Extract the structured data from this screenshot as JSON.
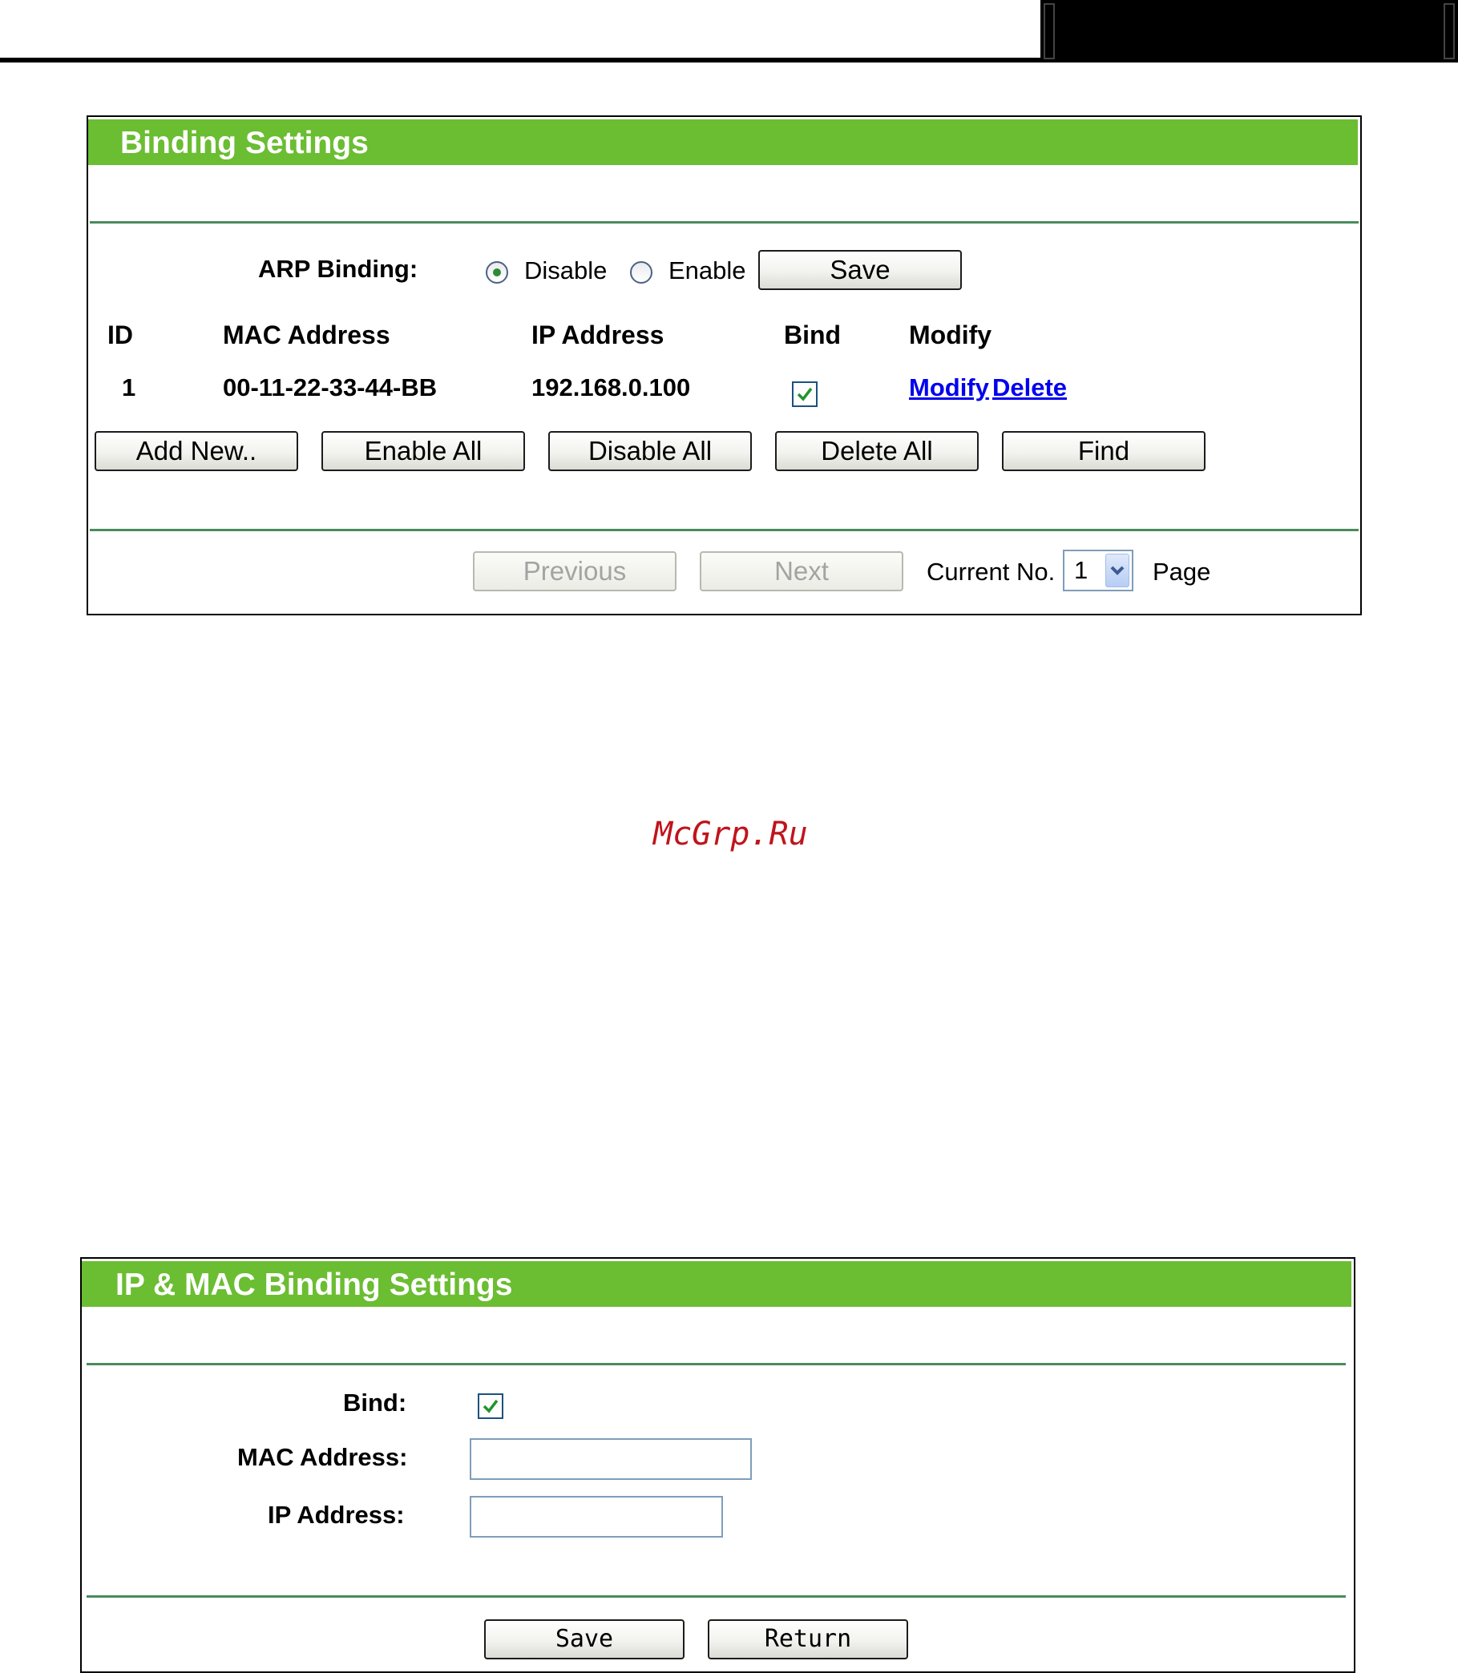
{
  "binding_settings": {
    "title": "Binding Settings",
    "arp_binding_label": "ARP Binding:",
    "arp_options": {
      "disable": {
        "label": "Disable",
        "selected": true
      },
      "enable": {
        "label": "Enable",
        "selected": false
      }
    },
    "save_label": "Save",
    "columns": [
      "ID",
      "MAC Address",
      "IP Address",
      "Bind",
      "Modify"
    ],
    "rows": [
      {
        "id": "1",
        "mac": "00-11-22-33-44-BB",
        "ip": "192.168.0.100",
        "bind": true,
        "modify_label": "Modify",
        "delete_label": "Delete"
      }
    ],
    "actions": {
      "add_new": "Add New..",
      "enable_all": "Enable All",
      "disable_all": "Disable All",
      "delete_all": "Delete All",
      "find": "Find"
    },
    "pager": {
      "previous": "Previous",
      "next": "Next",
      "current_label": "Current No.",
      "current_value": "1",
      "page_label": "Page"
    }
  },
  "watermark": "McGrp.Ru",
  "ip_mac_binding": {
    "title": "IP & MAC Binding Settings",
    "bind_label": "Bind:",
    "bind_checked": true,
    "mac_label": "MAC Address:",
    "mac_value": "",
    "ip_label": "IP Address:",
    "ip_value": "",
    "save_label": "Save",
    "return_label": "Return"
  },
  "colors": {
    "header_green": "#6bbd32",
    "rule_green": "#4a8b5c",
    "link_blue": "#0000ee",
    "watermark_red": "#c0141c"
  }
}
